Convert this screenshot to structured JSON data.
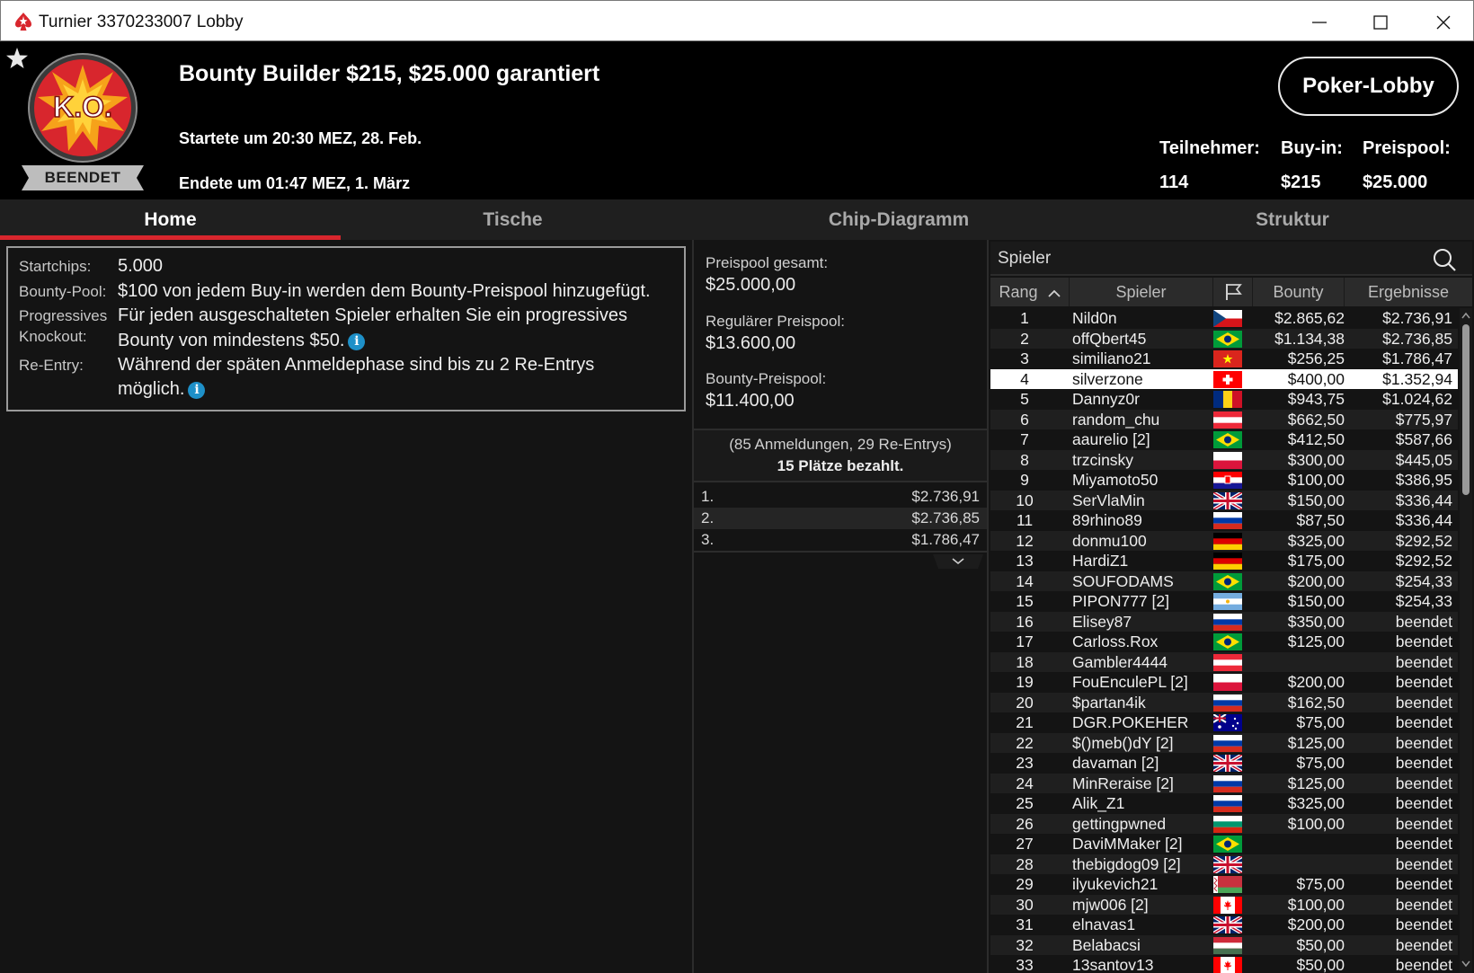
{
  "window": {
    "title": "Turnier 3370233007 Lobby",
    "minimize_label": "minimize",
    "maximize_label": "maximize",
    "close_label": "close"
  },
  "header": {
    "logo_text": "K.O.",
    "status": "BEENDET",
    "title": "Bounty Builder $215, $25.000 garantiert",
    "start": "Startete um 20:30 MEZ, 28. Feb.",
    "end": "Endete um 01:47 MEZ, 1. März",
    "lobby_button": "Poker-Lobby",
    "stats": [
      {
        "label": "Teilnehmer:",
        "value": "114"
      },
      {
        "label": "Buy-in:",
        "value": "$215"
      },
      {
        "label": "Preispool:",
        "value": "$25.000"
      }
    ]
  },
  "tabs": [
    "Home",
    "Tische",
    "Chip-Diagramm",
    "Struktur"
  ],
  "info": {
    "startchips_label": "Startchips:",
    "startchips_value": "5.000",
    "bountypool_label": "Bounty-Pool:",
    "bountypool_value": "$100 von jedem Buy-in werden dem Bounty-Preispool hinzugefügt.",
    "pko_label_1": "Progressives",
    "pko_label_2": "Knockout:",
    "pko_value_1": "Für jeden ausgeschalteten Spieler erhalten Sie ein progressives",
    "pko_value_2": "Bounty von mindestens $50.",
    "reentry_label": "Re-Entry:",
    "reentry_value_1": "Während der späten Anmeldephase sind bis zu 2 Re-Entrys",
    "reentry_value_2": "möglich."
  },
  "prizes": {
    "total_label": "Preispool gesamt:",
    "total_value": "$25.000,00",
    "regular_label": "Regulärer Preispool:",
    "regular_value": "$13.600,00",
    "bounty_label": "Bounty-Preispool:",
    "bounty_value": "$11.400,00",
    "registrations": "(85 Anmeldungen, 29 Re-Entrys)",
    "paid_places": "15 Plätze bezahlt.",
    "payouts": [
      {
        "place": "1.",
        "amount": "$2.736,91"
      },
      {
        "place": "2.",
        "amount": "$2.736,85"
      },
      {
        "place": "3.",
        "amount": "$1.786,47"
      }
    ]
  },
  "players": {
    "search_placeholder": "Spieler",
    "columns": {
      "rank": "Rang",
      "player": "Spieler",
      "bounty": "Bounty",
      "result": "Ergebnisse"
    },
    "rows": [
      {
        "rank": "1",
        "name": "Nild0n",
        "flag": "CZ",
        "bounty": "$2.865,62",
        "result": "$2.736,91"
      },
      {
        "rank": "2",
        "name": "offQbert45",
        "flag": "BR",
        "bounty": "$1.134,38",
        "result": "$2.736,85"
      },
      {
        "rank": "3",
        "name": "similiano21",
        "flag": "VN",
        "bounty": "$256,25",
        "result": "$1.786,47"
      },
      {
        "rank": "4",
        "name": "silverzone",
        "flag": "CH",
        "bounty": "$400,00",
        "result": "$1.352,94"
      },
      {
        "rank": "5",
        "name": "Dannyz0r",
        "flag": "RO",
        "bounty": "$943,75",
        "result": "$1.024,62"
      },
      {
        "rank": "6",
        "name": "random_chu",
        "flag": "AT",
        "bounty": "$662,50",
        "result": "$775,97"
      },
      {
        "rank": "7",
        "name": "aaurelio [2]",
        "flag": "BR",
        "bounty": "$412,50",
        "result": "$587,66"
      },
      {
        "rank": "8",
        "name": "trzcinsky",
        "flag": "PL",
        "bounty": "$300,00",
        "result": "$445,05"
      },
      {
        "rank": "9",
        "name": "Miyamoto50",
        "flag": "HR",
        "bounty": "$100,00",
        "result": "$386,95"
      },
      {
        "rank": "10",
        "name": "SerVlaMin",
        "flag": "GB",
        "bounty": "$150,00",
        "result": "$336,44"
      },
      {
        "rank": "11",
        "name": "89rhino89",
        "flag": "RU",
        "bounty": "$87,50",
        "result": "$336,44"
      },
      {
        "rank": "12",
        "name": "donmu100",
        "flag": "DE",
        "bounty": "$325,00",
        "result": "$292,52"
      },
      {
        "rank": "13",
        "name": "HardiZ1",
        "flag": "DE",
        "bounty": "$175,00",
        "result": "$292,52"
      },
      {
        "rank": "14",
        "name": "SOUFODAMS",
        "flag": "BR",
        "bounty": "$200,00",
        "result": "$254,33"
      },
      {
        "rank": "15",
        "name": "PIPON777 [2]",
        "flag": "AR",
        "bounty": "$150,00",
        "result": "$254,33"
      },
      {
        "rank": "16",
        "name": "Elisey87",
        "flag": "RU",
        "bounty": "$350,00",
        "result": "beendet"
      },
      {
        "rank": "17",
        "name": "Carloss.Rox",
        "flag": "BR",
        "bounty": "$125,00",
        "result": "beendet"
      },
      {
        "rank": "18",
        "name": "Gambler4444",
        "flag": "AT",
        "bounty": "",
        "result": "beendet"
      },
      {
        "rank": "19",
        "name": "FouEnculePL [2]",
        "flag": "PL",
        "bounty": "$200,00",
        "result": "beendet"
      },
      {
        "rank": "20",
        "name": "$partan4ik",
        "flag": "RU",
        "bounty": "$162,50",
        "result": "beendet"
      },
      {
        "rank": "21",
        "name": "DGR.POKEHER",
        "flag": "AU",
        "bounty": "$75,00",
        "result": "beendet"
      },
      {
        "rank": "22",
        "name": "$()meb()dY [2]",
        "flag": "RU",
        "bounty": "$125,00",
        "result": "beendet"
      },
      {
        "rank": "23",
        "name": "davaman [2]",
        "flag": "GB",
        "bounty": "$75,00",
        "result": "beendet"
      },
      {
        "rank": "24",
        "name": "MinReraise [2]",
        "flag": "RU",
        "bounty": "$125,00",
        "result": "beendet"
      },
      {
        "rank": "25",
        "name": "Alik_Z1",
        "flag": "RU",
        "bounty": "$325,00",
        "result": "beendet"
      },
      {
        "rank": "26",
        "name": "gettingpwned",
        "flag": "BG",
        "bounty": "$100,00",
        "result": "beendet"
      },
      {
        "rank": "27",
        "name": "DaviMMaker [2]",
        "flag": "BR",
        "bounty": "",
        "result": "beendet"
      },
      {
        "rank": "28",
        "name": "thebigdog09 [2]",
        "flag": "GB",
        "bounty": "",
        "result": "beendet"
      },
      {
        "rank": "29",
        "name": "ilyukevich21",
        "flag": "BY",
        "bounty": "$75,00",
        "result": "beendet"
      },
      {
        "rank": "30",
        "name": "mjw006 [2]",
        "flag": "CA",
        "bounty": "$100,00",
        "result": "beendet"
      },
      {
        "rank": "31",
        "name": "elnavas1",
        "flag": "GB",
        "bounty": "$200,00",
        "result": "beendet"
      },
      {
        "rank": "32",
        "name": "Belabacsi",
        "flag": "HU",
        "bounty": "$50,00",
        "result": "beendet"
      },
      {
        "rank": "33",
        "name": "13santov13",
        "flag": "CA",
        "bounty": "$50,00",
        "result": "beendet"
      }
    ]
  },
  "colors": {
    "accent": "#d8262d",
    "selected_row": "#ffffff",
    "info_icon": "#1e90c8"
  }
}
